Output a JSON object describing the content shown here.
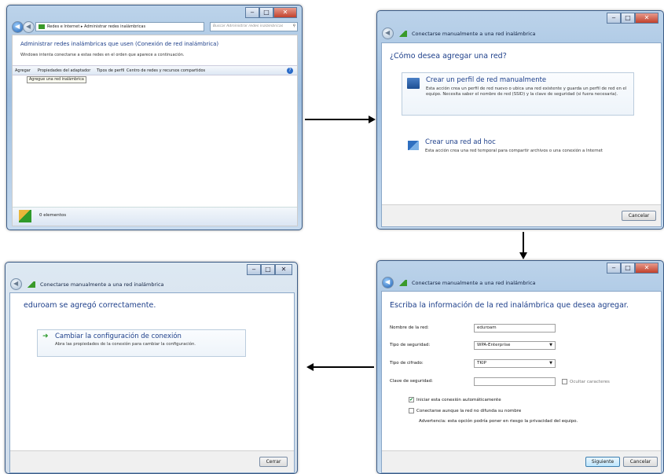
{
  "w1": {
    "breadcrumb": [
      "Redes e Internet",
      "Administrar redes inalámbricas"
    ],
    "search_placeholder": "Buscar Administrar redes inalámbricas",
    "heading": "Administrar redes inalámbricas que usen (Conexión de red inalámbrica)",
    "subtext": "Windows intenta conectarse a estas redes en el orden que aparece a continuación.",
    "toolbar": [
      "Agregar",
      "Propiedades del adaptador",
      "Tipos de perfil",
      "Centro de redes y recursos compartidos"
    ],
    "tooltip": "Agregue una red inalámbrica",
    "status": "0 elementos"
  },
  "w2": {
    "title": "Conectarse manualmente a una red inalámbrica",
    "question": "¿Cómo desea agregar una red?",
    "opt1_title": "Crear un perfil de red manualmente",
    "opt1_desc": "Esta acción crea un perfil de red nuevo o ubica una red existente y guarda un perfil de red en el equipo. Necesita saber el nombre de red (SSID) y la clave de seguridad (si fuera necesaria).",
    "opt2_title": "Crear una red ad hoc",
    "opt2_desc": "Esta acción crea una red temporal para compartir archivos o una conexión a Internet",
    "cancel": "Cancelar"
  },
  "w3": {
    "title": "Conectarse manualmente a una red inalámbrica",
    "heading": "Escriba la información de la red inalámbrica que desea agregar.",
    "name_label": "Nombre de la red:",
    "name_value": "eduroam",
    "sec_label": "Tipo de seguridad:",
    "sec_value": "WPA-Enterprise",
    "enc_label": "Tipo de cifrado:",
    "enc_value": "TKIP",
    "key_label": "Clave de seguridad:",
    "hide_chars": "Ocultar caracteres",
    "auto_start": "Iniciar esta conexión automáticamente",
    "connect_hidden": "Conectarse aunque la red no difunda su nombre",
    "warning": "Advertencia: esta opción podría poner en riesgo la privacidad del equipo.",
    "next": "Siguiente",
    "cancel": "Cancelar"
  },
  "w4": {
    "title": "Conectarse manualmente a una red inalámbrica",
    "heading": "eduroam se agregó correctamente.",
    "opt_title": "Cambiar la configuración de conexión",
    "opt_desc": "Abra las propiedades de la conexión para cambiar la configuración.",
    "close": "Cerrar"
  }
}
